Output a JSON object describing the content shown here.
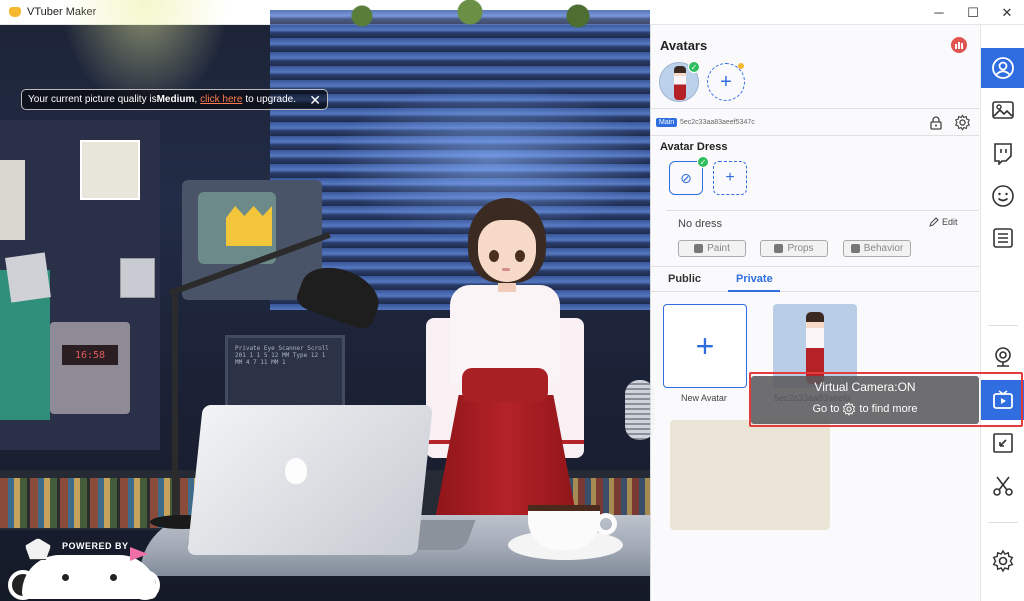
{
  "window": {
    "title": "VTuber Maker",
    "minimize": "─",
    "maximize": "☐",
    "close": "✕"
  },
  "banner": {
    "prefix": "Your current picture quality is ",
    "quality": "Medium",
    "comma": ",",
    "link": "click here",
    "suffix": " to upgrade.",
    "close": "✕"
  },
  "scene": {
    "radio_display": "16:58",
    "monitor_text": "Private Eye Scanner Scroll 201 1 1 5 12 MM Type 12 1 MM 4 7 11 MM 1",
    "watermark": "POWERED BY"
  },
  "panel": {
    "title": "Avatars",
    "avatar_id": "5ec2c33aa83aeef5347c",
    "main_tag": "Main",
    "add_symbol": "+",
    "check": "✓",
    "dress": {
      "title": "Avatar Dress",
      "none_symbol": "⊘",
      "add_symbol": "+",
      "current": "No dress",
      "edit": "Edit"
    },
    "chips": [
      {
        "label": "Paint"
      },
      {
        "label": "Props"
      },
      {
        "label": "Behavior"
      }
    ],
    "tabs": {
      "public": "Public",
      "private": "Private"
    },
    "new_avatar": {
      "symbol": "+",
      "label": "New Avatar"
    },
    "private_avatar_label": "5ec2c33aa83aeefa"
  },
  "virtual_camera": {
    "title": "Virtual Camera:ON",
    "go_to": "Go to",
    "find_more": "to find more"
  },
  "sidebar": {
    "items": [
      {
        "name": "avatar",
        "icon": "person-icon",
        "active": true
      },
      {
        "name": "background",
        "icon": "image-icon",
        "active": false
      },
      {
        "name": "twitch",
        "icon": "twitch-icon",
        "active": false
      },
      {
        "name": "expression",
        "icon": "smiley-icon",
        "active": false
      },
      {
        "name": "script",
        "icon": "list-icon",
        "active": false
      },
      {
        "name": "webcam",
        "icon": "webcam-icon",
        "active": false
      },
      {
        "name": "virtual-camera",
        "icon": "tv-icon",
        "active": true
      },
      {
        "name": "pip",
        "icon": "pip-icon",
        "active": false
      },
      {
        "name": "clip",
        "icon": "scissors-icon",
        "active": false
      },
      {
        "name": "settings",
        "icon": "gear-icon",
        "active": false
      }
    ]
  },
  "colors": {
    "accent": "#2f6de0",
    "highlight_border": "#e23c3c",
    "badge_green": "#2ebd5f",
    "link_orange": "#ff7a4d"
  }
}
